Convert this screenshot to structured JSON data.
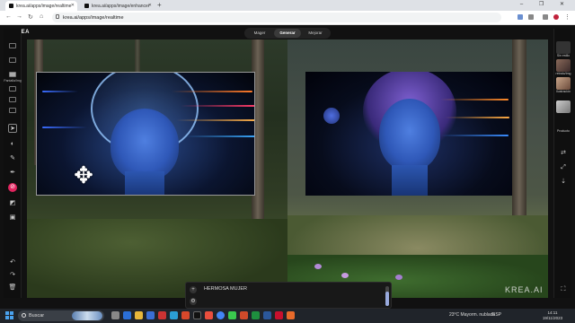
{
  "browser": {
    "tabs": [
      {
        "title": "krea.ai/apps/image/realtime",
        "active": true
      },
      {
        "title": "krea.ai/apps/image/enhancer",
        "active": false
      }
    ],
    "url": "krea.ai/apps/image/realtime",
    "new_tab": "+",
    "window_controls": "–  ❐  ✕"
  },
  "app": {
    "brand": "KREA",
    "modes": [
      "Mager",
      "Generar",
      "Mejorar"
    ],
    "active_mode": "Generar",
    "left_panel_label": "Pantalla/Img",
    "prompt": {
      "text": "HERMOSA MUJER",
      "strength": 0.75
    },
    "watermark": "KREA.AI",
    "right_panel": {
      "items": [
        {
          "label": "Sin estilo"
        },
        {
          "label": "retrato/Img"
        },
        {
          "label": "Ilustración"
        },
        {
          "label": "Producto"
        }
      ]
    },
    "accent": "#e0245e"
  },
  "taskbar": {
    "search": "Buscar",
    "weather": "23°C  Mayorm. nublado",
    "lang": "ESP",
    "time": "14:11",
    "date": "19/11/2023"
  }
}
